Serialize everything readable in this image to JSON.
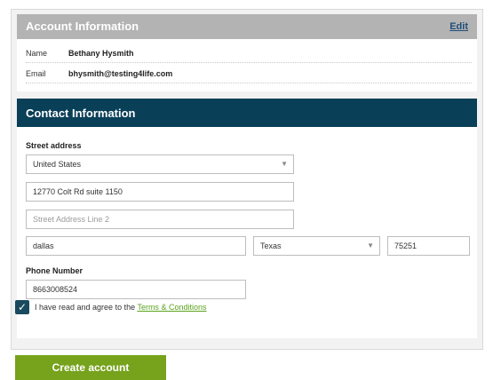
{
  "account": {
    "title": "Account Information",
    "edit_label": "Edit",
    "name_label": "Name",
    "name_value": "Bethany Hysmith",
    "email_label": "Email",
    "email_value": "bhysmith@testing4life.com"
  },
  "contact": {
    "title": "Contact Information",
    "street_label": "Street address",
    "country_value": "United States",
    "address_line1": "12770 Colt Rd suite 1150",
    "address_line2_placeholder": "Street Address Line 2",
    "city_value": "dallas",
    "state_value": "Texas",
    "zip_value": "75251",
    "phone_label": "Phone Number",
    "phone_value": "8663008524",
    "terms_checked": true,
    "terms_prefix": "I have read and agree to the",
    "terms_link": "Terms & Conditions"
  },
  "create_button": "Create account",
  "icons": {
    "select_arrow": "chevron-down-icon",
    "check": "check-icon"
  },
  "colors": {
    "accent_green": "#76a21c",
    "contact_header": "#0a3f58",
    "account_header": "#b3b3b3",
    "link": "#1f4e79"
  }
}
